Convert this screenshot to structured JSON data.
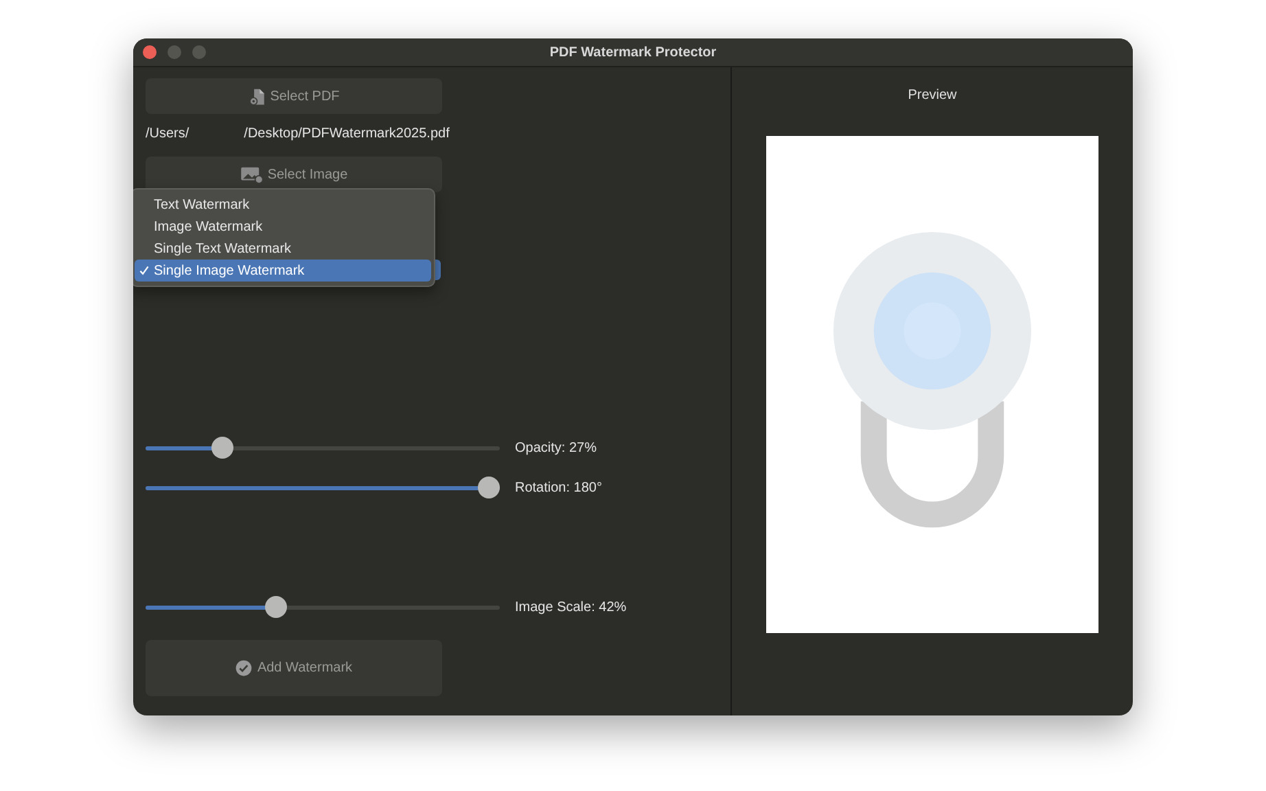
{
  "window": {
    "title": "PDF Watermark Protector"
  },
  "select_pdf_button": {
    "label": "Select PDF"
  },
  "file_path": {
    "start": "/Users/",
    "end": "/Desktop/PDFWatermark2025.pdf"
  },
  "select_image_button": {
    "label": "Select Image"
  },
  "mode_menu": {
    "options": [
      {
        "label": "Text Watermark",
        "selected": false
      },
      {
        "label": "Image Watermark",
        "selected": false
      },
      {
        "label": "Single Text Watermark",
        "selected": false
      },
      {
        "label": "Single Image Watermark",
        "selected": true
      }
    ]
  },
  "sliders": [
    {
      "label": "Opacity: 27%",
      "level": 0.2
    },
    {
      "label": "Rotation: 180°",
      "level": 1.0
    }
  ],
  "scale_slider": {
    "label": "Image Scale: 42%",
    "level": 0.36
  },
  "add_watermark_button": {
    "label": "Add Watermark"
  },
  "preview": {
    "title": "Preview"
  }
}
